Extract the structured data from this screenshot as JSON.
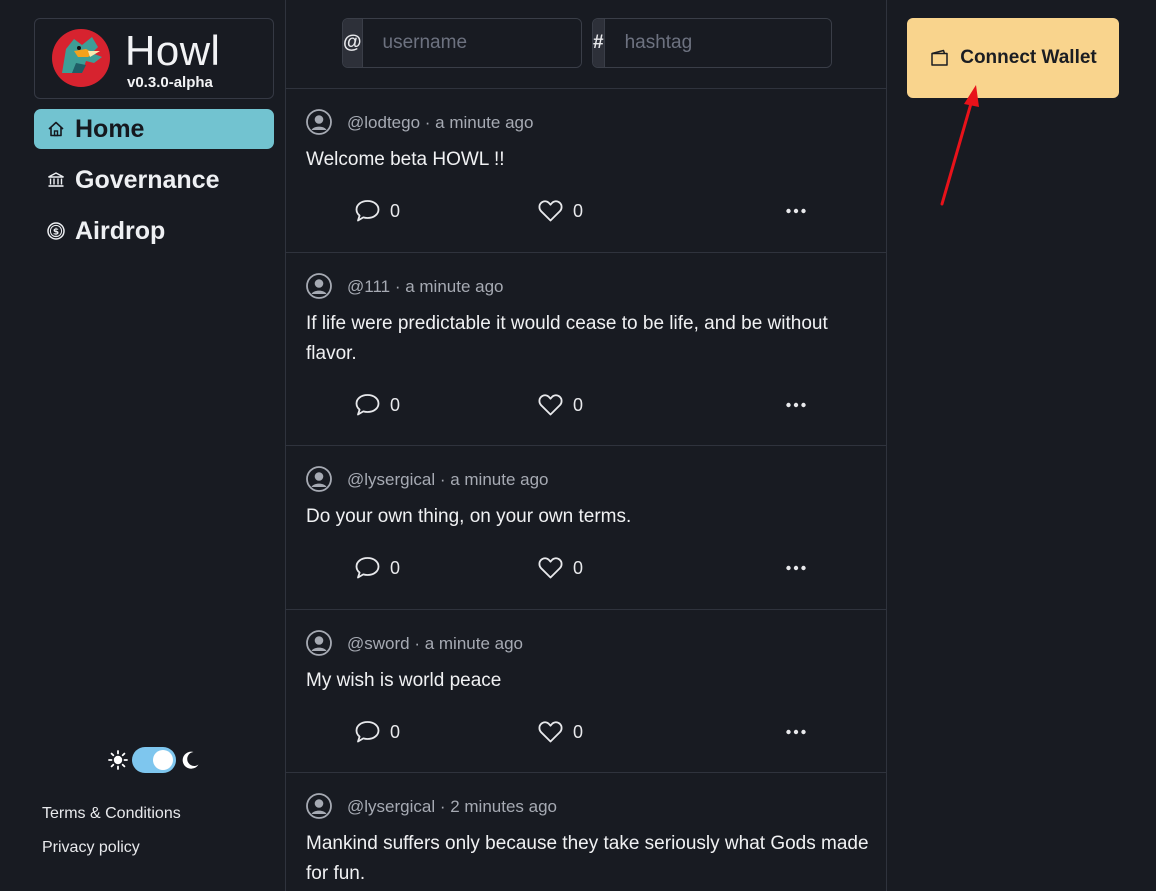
{
  "app": {
    "name": "Howl",
    "version": "v0.3.0-alpha"
  },
  "nav": [
    {
      "label": "Home",
      "icon": "home-icon",
      "active": true
    },
    {
      "label": "Governance",
      "icon": "bank-icon",
      "active": false
    },
    {
      "label": "Airdrop",
      "icon": "coin-icon",
      "active": false
    }
  ],
  "theme": {
    "mode": "dark"
  },
  "footer": {
    "terms": "Terms & Conditions",
    "privacy": "Privacy policy"
  },
  "search": {
    "user_prefix": "@",
    "user_placeholder": "username",
    "tag_prefix": "#",
    "tag_placeholder": "hashtag"
  },
  "posts": [
    {
      "meta": "@lodtego · a minute ago",
      "body": "Welcome beta HOWL !!",
      "comments": "0",
      "likes": "0"
    },
    {
      "meta": "@111 · a minute ago",
      "body": "If life were predictable it would cease to be life, and be without flavor.",
      "comments": "0",
      "likes": "0"
    },
    {
      "meta": "@lysergical · a minute ago",
      "body": "Do your own thing, on your own terms.",
      "comments": "0",
      "likes": "0"
    },
    {
      "meta": "@sword · a minute ago",
      "body": "My wish is world peace",
      "comments": "0",
      "likes": "0"
    },
    {
      "meta": "@lysergical · 2 minutes ago",
      "body": "Mankind suffers only because they take seriously what Gods made for fun.",
      "comments": "",
      "likes": ""
    }
  ],
  "wallet": {
    "label": "Connect Wallet"
  },
  "colors": {
    "background": "#181b22",
    "nav_active": "#72c3d0",
    "wallet_button": "#f9d48d",
    "annotation_arrow": "#e8121a"
  }
}
